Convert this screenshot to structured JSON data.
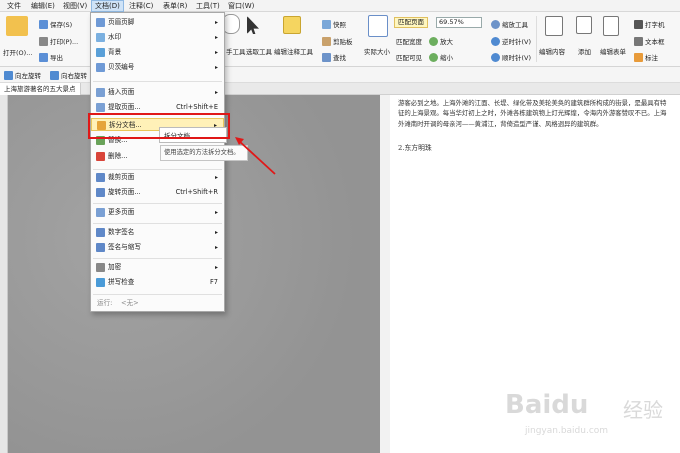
{
  "menubar": {
    "items": [
      "文件",
      "编辑(E)",
      "视图(V)",
      "文档(D)",
      "注释(C)",
      "表单(R)",
      "工具(T)",
      "窗口(W)"
    ],
    "active_item": "文档(D)"
  },
  "ribbon": {
    "open": "打开(O)...",
    "save": "保存(S)",
    "print": "打印(P)...",
    "export": "导出",
    "hand_tool": "手工具",
    "select_tool": "选取工具",
    "edit_annot": "编辑注释工具",
    "snapshot": "快照",
    "clipboard": "剪贴板",
    "find": "查找",
    "actual_size": "实际大小",
    "fit_page": "匹配页面",
    "fit_width": "匹配宽度",
    "fit_visible": "匹配可见",
    "zoom_value": "69.57%",
    "zoom_tool": "缩放工具",
    "zoom_in": "放大",
    "zoom_out": "缩小",
    "rotate_ccw": "逆时针(V)",
    "rotate_cw": "顺时针(V)",
    "edit_content": "编辑内容",
    "add": "添加",
    "edit_form": "编辑表单",
    "typewriter": "打字机",
    "textbox": "文本框",
    "annotate": "标注"
  },
  "rotbar": {
    "rotate_left": "向左旋转",
    "rotate_right": "向右旋转"
  },
  "tab": {
    "title": "上海旅游著名的五大景点"
  },
  "menu": {
    "items": [
      {
        "label": "页眉页脚",
        "arrow": "▸"
      },
      {
        "label": "水印",
        "arrow": "▸"
      },
      {
        "label": "背景",
        "arrow": "▸"
      },
      {
        "label": "贝茨编号",
        "arrow": "▸"
      },
      {
        "label": "插入页面",
        "arrow": "▸"
      },
      {
        "label": "提取页面...",
        "shortcut": "Ctrl+Shift+E"
      },
      {
        "label": "拆分文档...",
        "arrow": "▸"
      },
      {
        "label": "替换..."
      },
      {
        "label": "删除..."
      },
      {
        "label": "裁剪页面",
        "arrow": "▸"
      },
      {
        "label": "旋转页面...",
        "shortcut": "Ctrl+Shift+R"
      },
      {
        "label": "更多页面",
        "arrow": "▸"
      },
      {
        "label": "数字签名",
        "arrow": "▸"
      },
      {
        "label": "签名与缩写",
        "arrow": "▸"
      },
      {
        "label": "加密",
        "arrow": "▸"
      },
      {
        "label": "拼写检查",
        "shortcut": "F7"
      }
    ],
    "footer_label": "运行:",
    "footer_value": "<无>"
  },
  "submenu": {
    "item": "拆分文档..."
  },
  "tooltip": {
    "text": "使用选定的方法拆分文档。"
  },
  "document": {
    "paragraph": "游客必到之地。上海外滩的江面、长堤、绿化带及美轮美奂的建筑群所构成的街景，是最具有特征的上海景观。每当华灯初上之时，外滩各栋建筑物上灯光辉煌，令海内外游客赞叹不已。上海外滩南时开调的母亲河——黄浦江，背倚造型严谨、风格迥异的建筑群。",
    "heading": "2.东方明珠"
  },
  "watermark": {
    "brand": "Baidu",
    "cn": "经验",
    "url": "jingyan.baidu.com"
  },
  "colors": {
    "highlight_box": "#e01818",
    "menu_highlight": "#fff1b8",
    "fit_button": "#fff7c0"
  }
}
